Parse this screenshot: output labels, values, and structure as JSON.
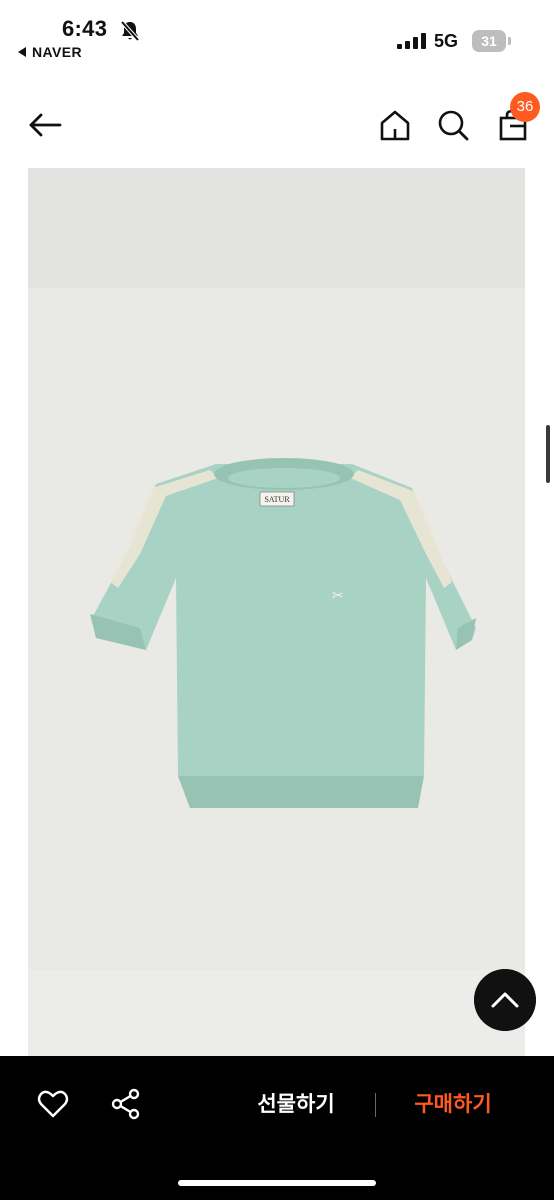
{
  "status_bar": {
    "time": "6:43",
    "back_app": "NAVER",
    "network": "5G",
    "battery": "31"
  },
  "header": {
    "cart_count": "36"
  },
  "product_image": {
    "label_text": "SATUR",
    "body_color": "#a8d2c3",
    "stripe_color": "#ece7d6"
  },
  "bottom_bar": {
    "gift_label": "선물하기",
    "buy_label": "구매하기"
  },
  "colors": {
    "accent": "#ff5a1f",
    "bottom_bar": "#000000"
  },
  "icons": [
    "back-arrow-icon",
    "home-icon",
    "search-icon",
    "cart-icon",
    "chevron-up-icon",
    "heart-icon",
    "share-icon",
    "mute-bell-icon",
    "signal-icon",
    "battery-icon"
  ]
}
